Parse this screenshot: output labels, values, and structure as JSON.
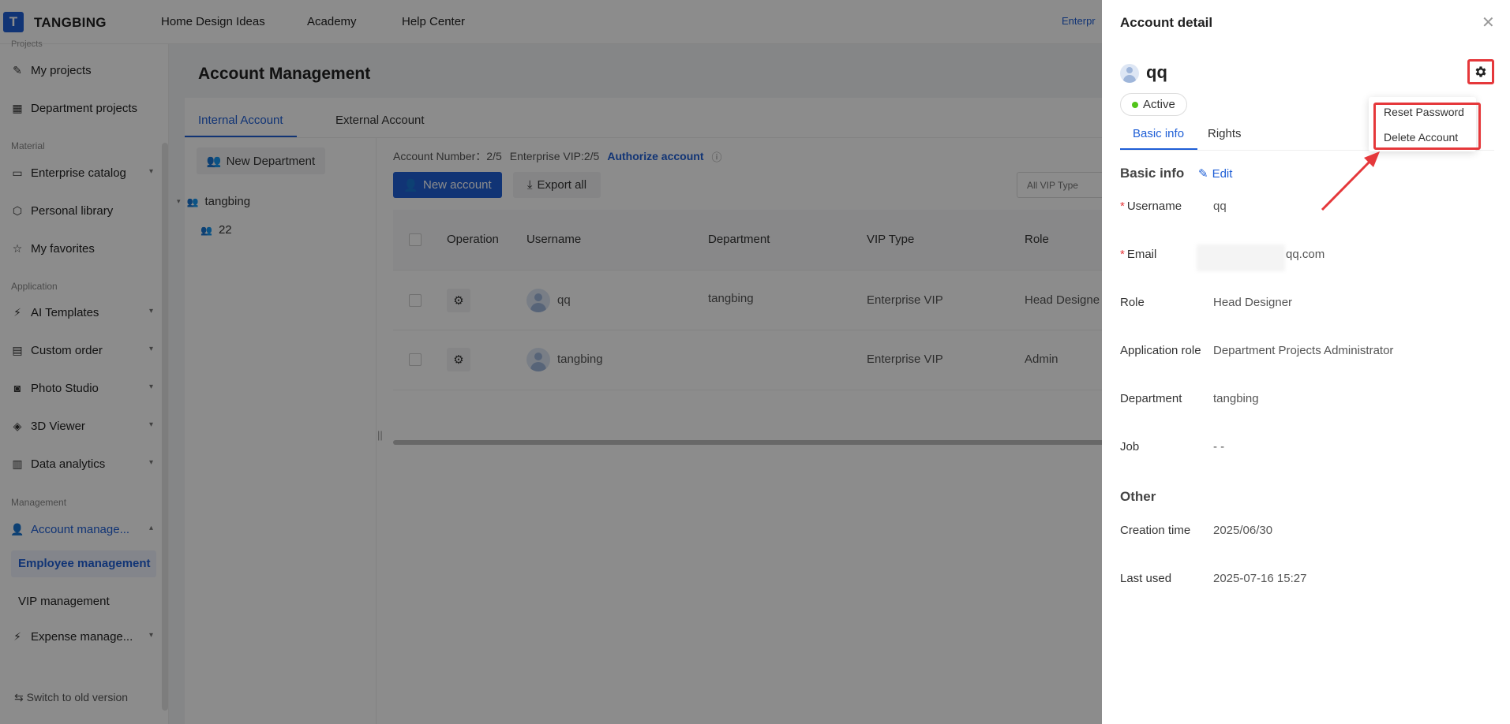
{
  "app": {
    "logo_letter": "T",
    "brand": "TANGBING",
    "nav": [
      "Home Design Ideas",
      "Academy",
      "Help Center"
    ],
    "enterprise_tag": "Enterpr"
  },
  "sidebar": {
    "cut_label": "Projects",
    "items_top": [
      {
        "label": "My projects",
        "icon": "pencil-box-icon"
      },
      {
        "label": "Department projects",
        "icon": "building-icon"
      }
    ],
    "section_material": "Material",
    "items_material": [
      {
        "label": "Enterprise catalog",
        "icon": "folder-icon"
      },
      {
        "label": "Personal library",
        "icon": "cube-icon"
      },
      {
        "label": "My favorites",
        "icon": "star-icon"
      }
    ],
    "section_application": "Application",
    "items_application": [
      {
        "label": "AI Templates",
        "icon": "ai-icon"
      },
      {
        "label": "Custom order",
        "icon": "clipboard-icon"
      },
      {
        "label": "Photo Studio",
        "icon": "camera-icon"
      },
      {
        "label": "3D Viewer",
        "icon": "viewer-icon"
      },
      {
        "label": "Data analytics",
        "icon": "bar-chart-icon"
      }
    ],
    "section_management": "Management",
    "account_management": "Account manage...",
    "sub_employee": "Employee management",
    "sub_vip": "VIP management",
    "expense": "Expense manage...",
    "footer": "Switch to old version"
  },
  "page": {
    "title": "Account Management",
    "tabs": [
      "Internal Account",
      "External Account"
    ],
    "new_department": "New Department",
    "tree": {
      "root": "tangbing",
      "child_count": "22"
    },
    "meta": {
      "account_number": "Account Number：2/5",
      "enterprise_vip": "Enterprise VIP:2/5",
      "authorize": "Authorize account"
    },
    "new_account": "New account",
    "export_all": "Export all",
    "vip_filter": "All VIP Type",
    "columns": [
      "Operation",
      "Username",
      "Department",
      "VIP Type",
      "Role"
    ],
    "rows": [
      {
        "username": "qq",
        "department": "tangbing",
        "vip": "Enterprise VIP",
        "role": "Head Designe"
      },
      {
        "username": "tangbing",
        "department": "",
        "vip": "Enterprise VIP",
        "role": "Admin"
      }
    ]
  },
  "drawer": {
    "title": "Account detail",
    "name": "qq",
    "status": "Active",
    "tabs": [
      "Basic info",
      "Rights"
    ],
    "menu": [
      "Reset Password",
      "Delete Account"
    ],
    "basic_heading": "Basic info",
    "edit": "Edit",
    "fields": {
      "username_label": "Username",
      "username": "qq",
      "email_label": "Email",
      "email": "qq.com",
      "role_label": "Role",
      "role": "Head Designer",
      "app_role_label": "Application role",
      "app_role": "Department Projects Administrator",
      "department_label": "Department",
      "department": "tangbing",
      "job_label": "Job",
      "job": "- -"
    },
    "other_heading": "Other",
    "other": {
      "creation_label": "Creation time",
      "creation": "2025/06/30",
      "last_used_label": "Last used",
      "last_used": "2025-07-16 15:27"
    }
  },
  "colors": {
    "accent": "#1f5fd6",
    "highlight": "#e5383b",
    "active_dot": "#52c41a"
  }
}
